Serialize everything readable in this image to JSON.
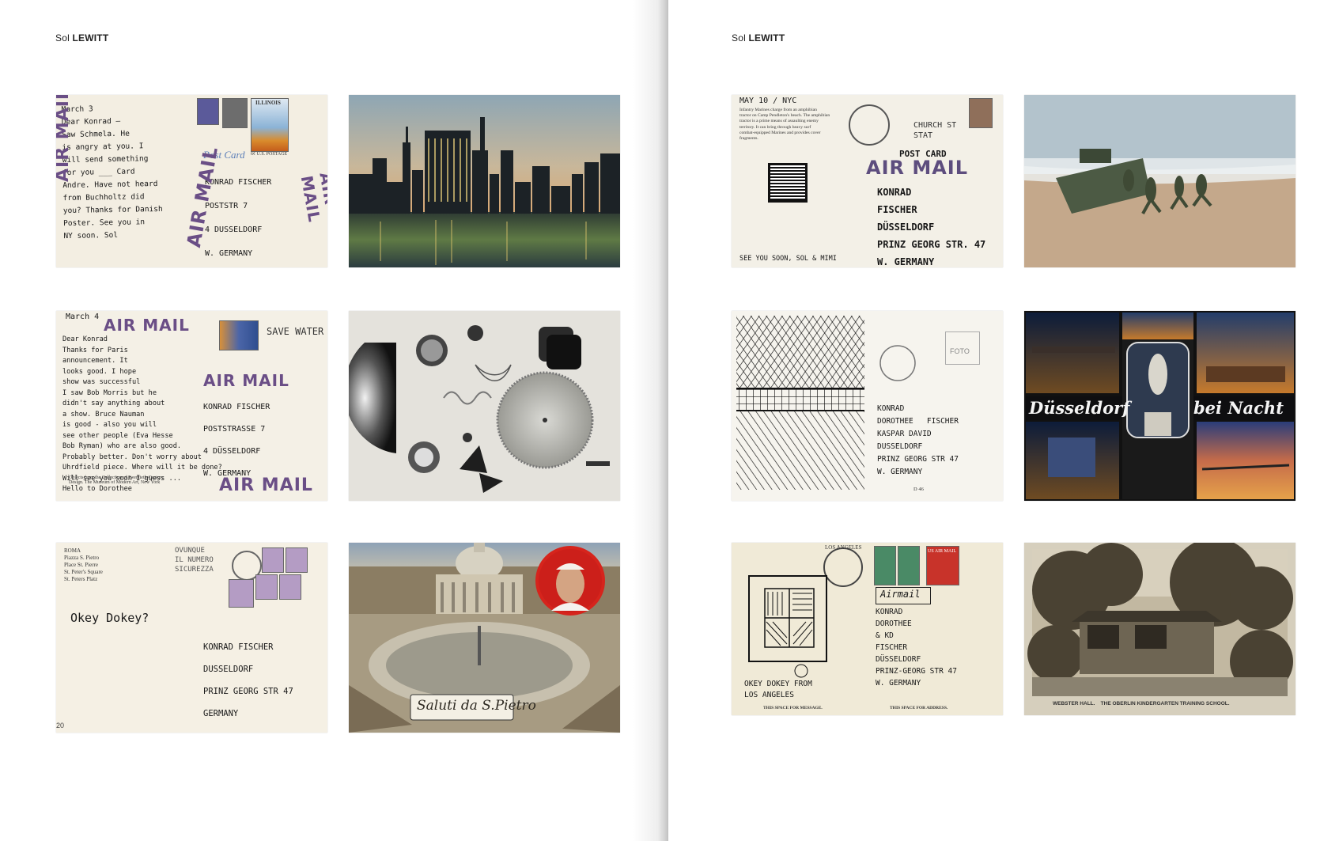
{
  "running_head": {
    "first": "Sol",
    "last": "LEWITT"
  },
  "page_number_left": "20",
  "cards": {
    "c1": {
      "message": "March 3\nDear Konrad —\nSaw Schmela. He\nis angry at you. I\nwill send something\nfor you ___ Card\nAndre. Have not heard\nfrom Buchholtz did\nyou? Thanks for Danish\nPoster. See you in\nNY soon. Sol",
      "address": "KONRAD FISCHER\nPOSTSTR 7\n4 DUSSELDORF\nW. GERMANY",
      "airmail": "AIR MAIL",
      "postcard_label": "Post Card",
      "stamp_text": "ILLINOIS",
      "stamp_value": "6¢ U.S. POSTAGE"
    },
    "c2": {
      "caption": ""
    },
    "c3": {
      "header": "March 4",
      "message": "Dear Konrad\nThanks for Paris\nannouncement. It\nlooks good. I hope\nshow was successful\nI saw Bob Morris but he\ndidn't say anything about\na show. Bruce Nauman\nis good - also you will\nsee other people (Eva Hesse\nBob Ryman) who are also good.\nProbably better. Don't worry about\nUhrdfield piece. Where will it be done?\nWill see you soon I guess ...\nHello to Dorothee",
      "address": "KONRAD FISCHER\nPOSTSTRASSE 7\n4 DÜSSELDORF\nW. GERMANY",
      "airmail": "AIR MAIL",
      "cancel": "SAVE WATER",
      "small_print": "Objects from the Collection of Twentieth-Century\nDesign. The Museum of Modern Art, New York"
    },
    "c5": {
      "caption_lines": "ROMA\nPiazza S. Pietro\nPlace St. Pierre\nSt. Peter's Square\nSt. Peters Platz",
      "postmark": "OVUNQUE\nIL NUMERO\nSICUREZZA",
      "message": "Okey Dokey?",
      "address": "KONRAD FISCHER\nDUSSELDORF\nPRINZ GEORG STR 47\nGERMANY"
    },
    "c6": {
      "caption": "Saluti da S.Pietro"
    },
    "c7": {
      "header": "MAY 10 / NYC",
      "caption": "Infantry Marines charge from an amphibian\ntractor on Camp Pendleton's beach. The amphibian\ntractor is a prime means of assaulting enemy\nterritory. It can bring through heavy surf\ncombat-equipped Marines and provides cover\nfragments.",
      "postmark": "CHURCH ST\nSTAT",
      "postcard_label": "POST CARD",
      "airmail": "AIR MAIL",
      "address": "KONRAD\nFISCHER\nDÜSSELDORF\nPRINZ GEORG STR. 47\nW. GERMANY",
      "signoff": "SEE YOU SOON, SOL & MIMI"
    },
    "c9": {
      "foto_label": "FOTO",
      "address": "KONRAD\nDOROTHEE   FISCHER\nKASPAR DAVID\nDUSSELDORF\nPRINZ GEORG STR 47\nW. GERMANY",
      "code": "D 46"
    },
    "c10": {
      "caption_left": "Düsseldorf",
      "caption_right": "bei Nacht"
    },
    "c11": {
      "postmark": "LOS ANGELES",
      "airmail": "Airmail",
      "stamp_text": "US AIR MAIL",
      "address": "KONRAD\nDOROTHEE\n& KD\nFISCHER\nDÜSSELDORF\nPRINZ-GEORG STR 47\nW. GERMANY",
      "message": "OKEY DOKEY FROM\nLOS ANGELES",
      "space_message": "THIS SPACE FOR MESSAGE.",
      "space_address": "THIS SPACE FOR ADDRESS."
    },
    "c12": {
      "caption": "WEBSTER HALL.    THE OBERLIN KINDERGARTEN TRAINING SCHOOL."
    }
  }
}
